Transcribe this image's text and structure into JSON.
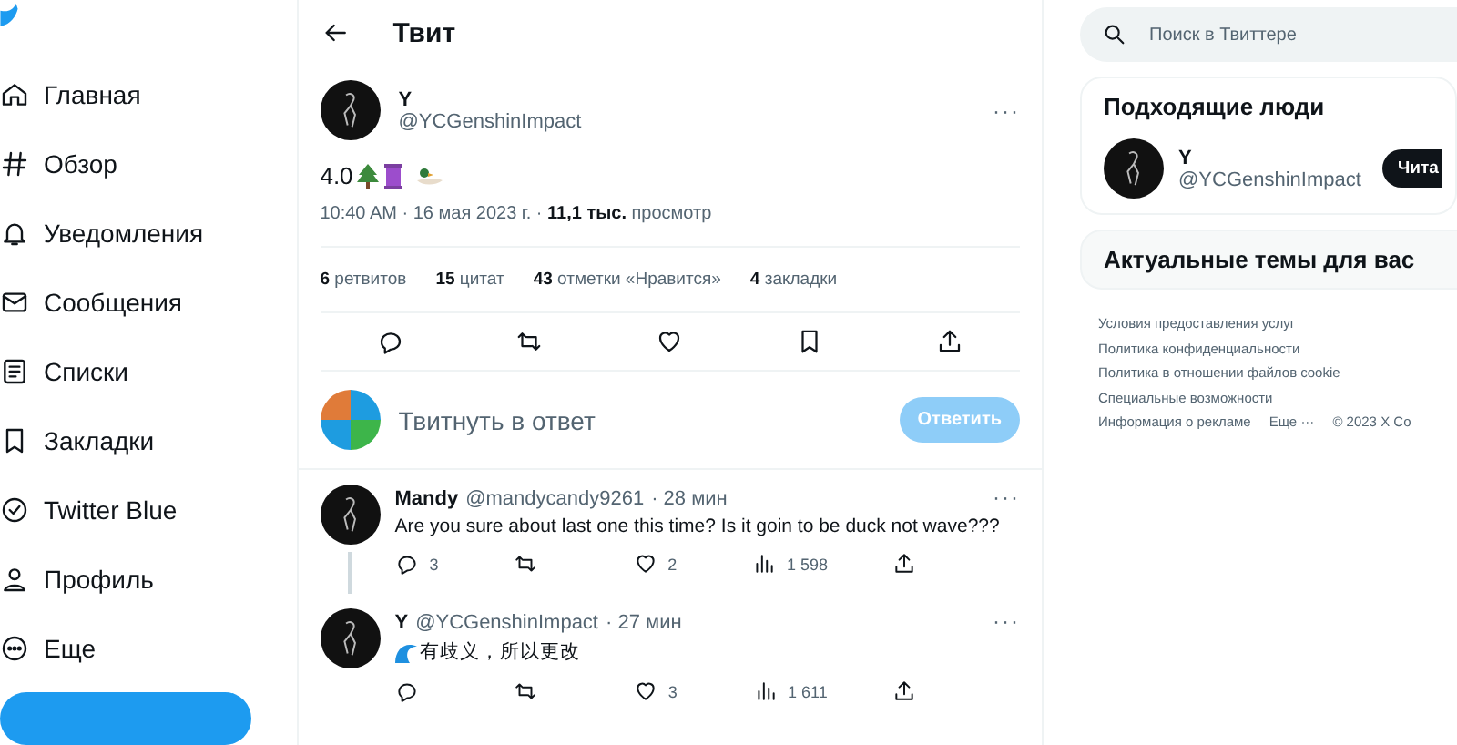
{
  "nav": {
    "items": [
      {
        "label": "Главная",
        "selected": false
      },
      {
        "label": "Обзор",
        "selected": false
      },
      {
        "label": "Уведомления",
        "selected": false
      },
      {
        "label": "Сообщения",
        "selected": false
      },
      {
        "label": "Списки",
        "selected": false
      },
      {
        "label": "Закладки",
        "selected": false
      },
      {
        "label": "Twitter Blue",
        "selected": false
      },
      {
        "label": "Профиль",
        "selected": false
      },
      {
        "label": "Еще",
        "selected": false
      }
    ]
  },
  "header": {
    "title": "Твит"
  },
  "tweet": {
    "menu": "···",
    "name": "Y",
    "handle": "@YCGenshinImpact",
    "text": "4.0",
    "time": "10:40 AM · 16 мая 2023 г. · ",
    "views_count": "11,1 тыс.",
    "views_label": " просмотр",
    "stats": [
      {
        "count": "6",
        "label": "ретвитов"
      },
      {
        "count": "15",
        "label": "цитат"
      },
      {
        "count": "43",
        "label": "отметки «Нравится»"
      },
      {
        "count": "4",
        "label": "закладки"
      }
    ]
  },
  "composer": {
    "placeholder": "Твитнуть в ответ",
    "button": "Ответить",
    "disabled": true
  },
  "replies": [
    {
      "menu": "···",
      "name": "Mandy",
      "handle": "@mandycandy9261",
      "time": "· 28 мин",
      "text": "Are you sure about last one this time? Is it goin to be duck not wave???",
      "wave": false,
      "thread": true,
      "replies": "3",
      "likes": "2",
      "views": "1 598"
    },
    {
      "menu": "···",
      "name": "Y",
      "handle": "@YCGenshinImpact",
      "time": "· 27 мин",
      "text": "有歧义，所以更改",
      "wave": true,
      "thread": false,
      "likes": "3",
      "views": "1 611"
    }
  ],
  "search": {
    "placeholder": "Поиск в Твиттере"
  },
  "who_to_follow": {
    "title": "Подходящие люди",
    "users": [
      {
        "name": "Y",
        "handle": "@YCGenshinImpact",
        "button": "Чита"
      }
    ]
  },
  "trends": {
    "title": "Актуальные темы для вас"
  },
  "footer": {
    "lines": [
      [
        "Условия предоставления услуг"
      ],
      [
        "Политика конфиденциальности"
      ],
      [
        "Политика в отношении файлов cookie"
      ],
      [
        "Специальные возможности"
      ],
      [
        "Информация о рекламе",
        "Еще ···",
        "© 2023 X Co"
      ]
    ]
  }
}
